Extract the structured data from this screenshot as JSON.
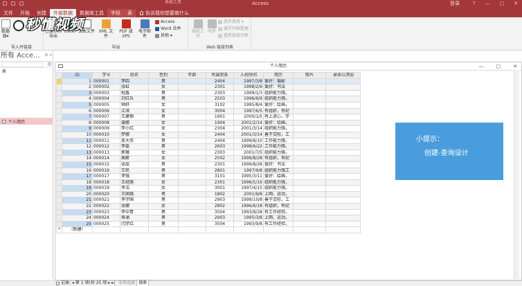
{
  "title_bar": {
    "app_title": "Access",
    "context_group": "表格工具",
    "login": "登录",
    "window_controls": [
      "?",
      "—",
      "□",
      "✕"
    ]
  },
  "tabs": [
    {
      "label": "文件",
      "active": false
    },
    {
      "label": "开始",
      "active": false
    },
    {
      "label": "创建",
      "active": false
    },
    {
      "label": "外部数据",
      "active": true
    },
    {
      "label": "数据库工具",
      "active": false
    },
    {
      "label": "字段",
      "active": false,
      "context": true
    },
    {
      "label": "表",
      "active": false,
      "context": true
    }
  ],
  "tell_me": "告诉我你想要做什么",
  "ribbon": {
    "import_group": {
      "label": "导入并链接",
      "btn_saved_import": "已保存的导入",
      "btn_access_partial": "数据\n源▾"
    },
    "export_group": {
      "label": "导出",
      "btn_saved_export": "已保存的\n导出",
      "btn_excel": "Excel",
      "btn_text": "文本文件",
      "btn_xml": "XML 文件",
      "btn_pdf": "PDF 或 XPS",
      "btn_email": "电子邮件",
      "small_access": "Access",
      "small_word": "Word 合并",
      "small_more": "其他 ▾"
    },
    "web_group": {
      "label": "Web 链接列表",
      "btn_work_offline": "脱机工作",
      "btn_sync": "同步",
      "small_relink": "放弃更改 ▾",
      "small_cache": "缓存列表数据",
      "small_relink_lists": "重新链接列表"
    }
  },
  "nav_pane": {
    "header": "所有 Acce...",
    "header_controls": "⊙ «",
    "section_label": "表",
    "item": "个人简历"
  },
  "document": {
    "title": "个人简历",
    "controls": [
      "—",
      "□",
      "✕"
    ]
  },
  "table": {
    "columns": [
      "ID",
      "学号",
      "姓名",
      "性别",
      "年龄",
      "所属院系",
      "入校时间",
      "简历",
      "照片",
      "单击以添加"
    ],
    "rows": [
      [
        "1",
        "000001",
        "李四",
        "男",
        "",
        "2404",
        "1997/3/8",
        "爱好：摄影"
      ],
      [
        "2",
        "000002",
        "张虹",
        "女",
        "",
        "2301",
        "1998/2/6",
        "爱好：书法"
      ],
      [
        "3",
        "000003",
        "程鑫",
        "男",
        "",
        "2303",
        "1999/1/3",
        "组织能力强，"
      ],
      [
        "4",
        "000004",
        "刘红兵",
        "男",
        "",
        "2503",
        "1996/6/9",
        "组织能力强，"
      ],
      [
        "5",
        "000005",
        "钟舒",
        "女",
        "",
        "3102",
        "1995/8/4",
        "爱好：绘画，"
      ],
      [
        "6",
        "000006",
        "江滨",
        "女",
        "",
        "3004",
        "1997/6/5",
        "有组织，有纪"
      ],
      [
        "7",
        "000007",
        "王建钢",
        "男",
        "",
        "1901",
        "2000/1/5",
        "有上进心，学"
      ],
      [
        "8",
        "000008",
        "璇娜",
        "女",
        "",
        "1904",
        "2001/2/14",
        "爱好：绘画，"
      ],
      [
        "9",
        "000009",
        "李小红",
        "女",
        "",
        "2304",
        "2001/3/14",
        "组织能力强，"
      ],
      [
        "10",
        "000010",
        "梦娜",
        "女",
        "",
        "2404",
        "2001/3/14",
        "善于交际，工"
      ],
      [
        "11",
        "000011",
        "吴大伟",
        "男",
        "",
        "2404",
        "1999/8/10",
        "工作能力强，"
      ],
      [
        "12",
        "000012",
        "李磊",
        "男",
        "",
        "2603",
        "1998/6/22",
        "工作能力强，"
      ],
      [
        "13",
        "000013",
        "郭薇",
        "女",
        "",
        "2303",
        "2001/7/5",
        "组织能力强，"
      ],
      [
        "14",
        "000014",
        "高薪",
        "女",
        "",
        "2502",
        "1999/8/28",
        "有组织，有纪"
      ],
      [
        "15",
        "000015",
        "张品",
        "男",
        "",
        "2301",
        "1999/8/28",
        "爱好：书法"
      ],
      [
        "16",
        "000016",
        "王民",
        "男",
        "",
        "2801",
        "1997/9/8",
        "组织能力强工"
      ],
      [
        "17",
        "000017",
        "李强",
        "男",
        "",
        "3101",
        "1995/3/11",
        "爱好：绘画，"
      ],
      [
        "18",
        "000018",
        "王经丽",
        "女",
        "",
        "2301",
        "1996/5/16",
        "组织能力强，"
      ],
      [
        "19",
        "000019",
        "李洁",
        "女",
        "",
        "3001",
        "1997/4/15",
        "组织能力强，"
      ],
      [
        "20",
        "000020",
        "王国强",
        "男",
        "",
        "1802",
        "2001/9/8",
        "上网，运动，"
      ],
      [
        "21",
        "000021",
        "李学国",
        "男",
        "",
        "2903",
        "1999/10/8",
        "善于交际，工"
      ],
      [
        "22",
        "000022",
        "张娜",
        "女",
        "",
        "2802",
        "1996/6/18",
        "有组织，有纪"
      ],
      [
        "23",
        "000023",
        "李中青",
        "男",
        "",
        "3504",
        "1993/8/28",
        "有工作经验，"
      ],
      [
        "24",
        "000024",
        "寿涌",
        "男",
        "",
        "2903",
        "1995/3/8",
        "上网，运动，"
      ],
      [
        "25",
        "000025",
        "闫学红",
        "男",
        "",
        "3504",
        "1993/9/8",
        "有工作经验，"
      ]
    ],
    "new_row_label": "（新建）"
  },
  "tip": {
    "line1": "小提示：",
    "line2": "创建-查询设计"
  },
  "watermark": "秒懂视频",
  "record_nav": {
    "text": "记录: ◂  第 1 项(共 25 项 ▸ ▸|",
    "filter": "无筛选器",
    "search": "搜索"
  },
  "colors": {
    "title_red": "#a4373a",
    "selection_blue": "#c6dcf2",
    "tip_blue": "#4a9ddc",
    "nav_selected": "#f6c7c8"
  }
}
